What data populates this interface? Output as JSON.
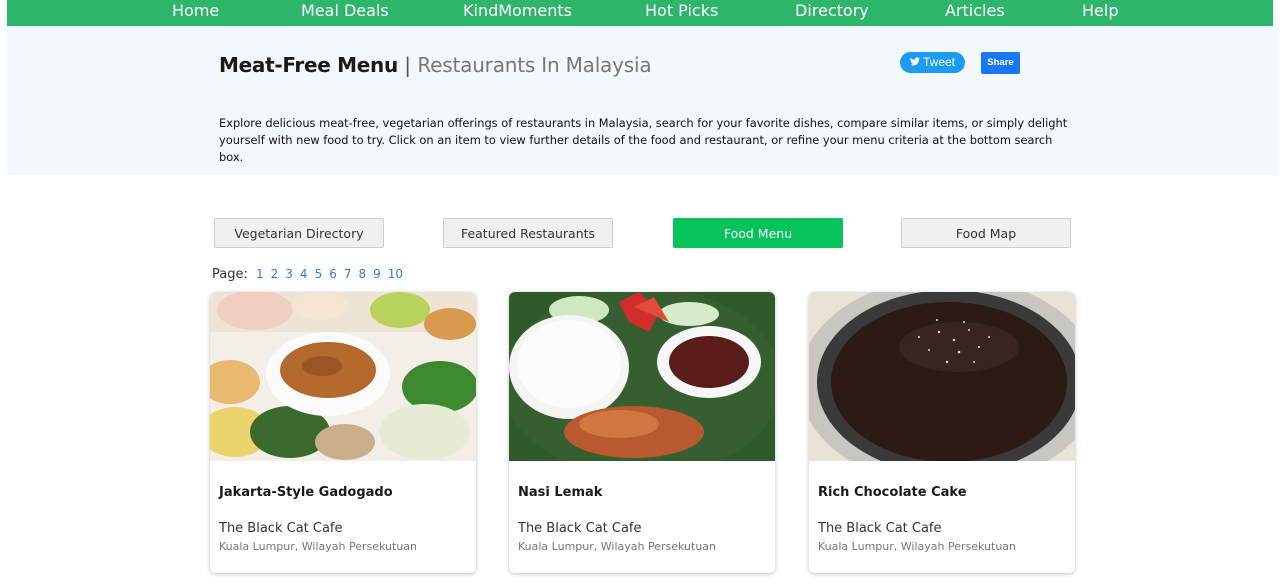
{
  "nav": {
    "items": [
      "Home",
      "Meal Deals",
      "KindMoments",
      "Hot Picks",
      "Directory",
      "Articles",
      "Help"
    ]
  },
  "hero": {
    "title_main": "Meat-Free Menu",
    "title_sep": "|",
    "title_sub": "Restaurants In Malaysia",
    "description": "Explore delicious meat-free, vegetarian offerings of restaurants in Malaysia, search for your favorite dishes, compare similar items, or simply delight yourself with new food to try. Click on an item to view further details of the food and restaurant, or refine your menu criteria at the bottom search box.",
    "tweet_label": "Tweet",
    "share_label": "Share"
  },
  "tabs": [
    {
      "label": "Vegetarian Directory",
      "active": false
    },
    {
      "label": "Featured Restaurants",
      "active": false
    },
    {
      "label": "Food Menu",
      "active": true
    },
    {
      "label": "Food Map",
      "active": false
    }
  ],
  "pager": {
    "label": "Page:",
    "pages": [
      "1",
      "2",
      "3",
      "4",
      "5",
      "6",
      "7",
      "8",
      "9",
      "10"
    ]
  },
  "cards": [
    {
      "name": "Jakarta-Style Gadogado",
      "restaurant": "The Black Cat Cafe",
      "location": "Kuala Lumpur, Wilayah Persekutuan",
      "image": "gadogado-photo"
    },
    {
      "name": "Nasi Lemak",
      "restaurant": "The Black Cat Cafe",
      "location": "Kuala Lumpur, Wilayah Persekutuan",
      "image": "nasi-lemak-photo"
    },
    {
      "name": "Rich Chocolate Cake",
      "restaurant": "The Black Cat Cafe",
      "location": "Kuala Lumpur, Wilayah Persekutuan",
      "image": "chocolate-cake-photo"
    }
  ],
  "colors": {
    "nav_bg": "#2db56b",
    "hero_bg": "#f2f8fc",
    "active_tab": "#06c25a",
    "link": "#2f7de1",
    "tweet": "#1d9bf0",
    "share": "#1877f2"
  }
}
